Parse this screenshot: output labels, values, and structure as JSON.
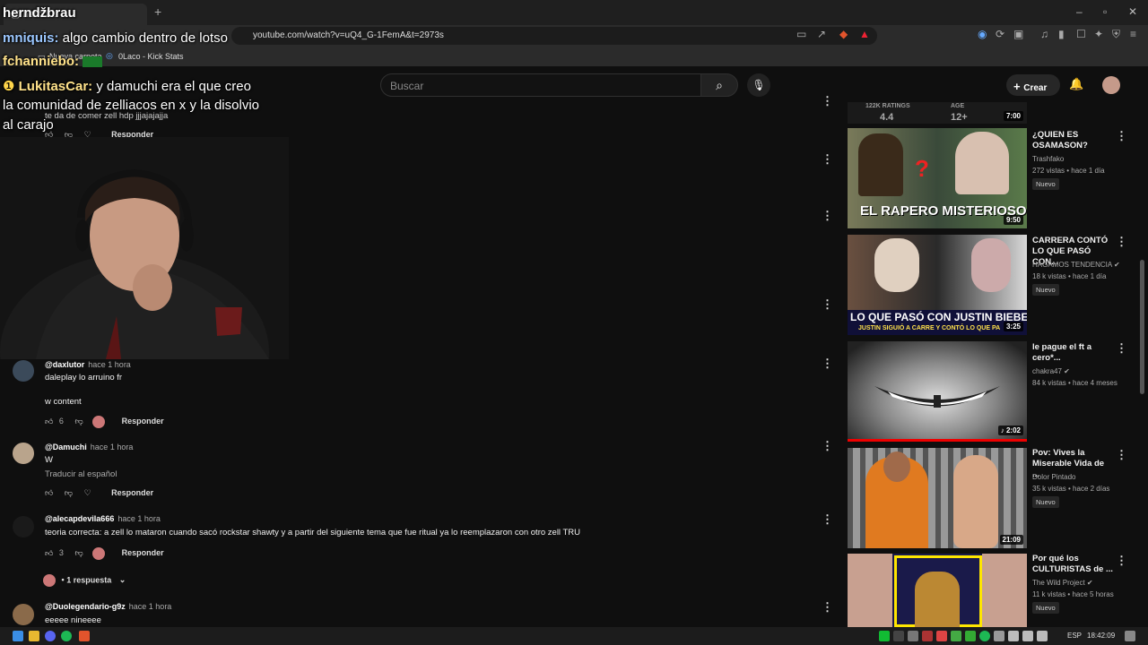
{
  "browser": {
    "tab_title": "hernd...",
    "tab_icon": "chrome-tab-icon",
    "url": "youtube.com/watch?v=uQ4_G-1FemA&t=2973s",
    "bookmarks": [
      {
        "label": "Nueva carpeta"
      },
      {
        "label": "0Laco - Kick Stats"
      }
    ]
  },
  "youtube": {
    "search_placeholder": "Buscar",
    "create_label": "Crear"
  },
  "chat_overlay": [
    {
      "user": "herndžbrau",
      "message": ""
    },
    {
      "user": "mniquis:",
      "message": " algo cambio dentro de lotso"
    },
    {
      "user": "fchanniebo:",
      "message": ""
    },
    {
      "user": "LukitasCar:",
      "message": " y damuchi era el que creo"
    },
    {
      "user": "",
      "message": "la comunidad de zelliacos en x y la disolvio"
    },
    {
      "user": "",
      "message": "al carajo"
    }
  ],
  "comments": [
    {
      "text": "te da de comer zell hdp jjjajajajja",
      "reply": "Responder"
    },
    {
      "handle": "@daxlutor",
      "time": "hace 1 hora",
      "line1": "daleplay lo arruino fr",
      "line2": "w content",
      "likes": "6",
      "reply": "Responder"
    },
    {
      "handle": "@Damuchi",
      "time": "hace 1 hora",
      "line1": "W",
      "line2": "Traducir al español",
      "reply": "Responder"
    },
    {
      "handle": "@alecapdevila666",
      "time": "hace 1 hora",
      "line1": "teoria correcta: a zell lo mataron cuando sacó rockstar shawty y a partir del siguiente tema que fue ritual ya lo reemplazaron con otro zell TRU",
      "likes": "3",
      "reply": "Responder",
      "replies": "1 respuesta"
    },
    {
      "handle": "@Duolegendario-g9z",
      "time": "hace 1 hora",
      "line1": "eeeee nineeee"
    }
  ],
  "sidebar": {
    "top_partial": {
      "ratings": "122K RATINGS",
      "age_label": "AGE",
      "rating": "4.4",
      "age": "12+",
      "duration": "7:00"
    },
    "videos": [
      {
        "title": "¿QUIEN ES OSAMASON?",
        "channel": "Trashfako",
        "meta": "272 vistas • hace 1 día",
        "badge": "Nuevo",
        "duration": "9:50",
        "thumb_text": "EL RAPERO MISTERIOSO"
      },
      {
        "title": "CARRERA CONTÓ LO QUE PASÓ CON...",
        "channel": "HAGAMOS TENDENCIA",
        "meta": "18 k vistas • hace 1 día",
        "badge": "Nuevo",
        "duration": "3:25",
        "thumb_text": "LO QUE PASÓ CON JUSTIN BIEBER",
        "thumb_sub": "JUSTIN SIGUIÓ A CARRE Y CONTÓ LO QUE PA"
      },
      {
        "title": "le pague el ft a cero*...",
        "channel": "chakra47",
        "meta": "84 k vistas • hace 4 meses",
        "duration": "2:02"
      },
      {
        "title": "Pov: Vives la Miserable Vida de ...",
        "channel": "Dolor Pintado",
        "meta": "35 k vistas • hace 2 días",
        "badge": "Nuevo",
        "duration": "21:09"
      },
      {
        "title": "Por qué los CULTURISTAS de ...",
        "channel": "The Wild Project",
        "meta": "11 k vistas • hace 5 horas",
        "badge": "Nuevo"
      }
    ]
  },
  "taskbar": {
    "lang": "ESP",
    "time": "18:42:09"
  }
}
